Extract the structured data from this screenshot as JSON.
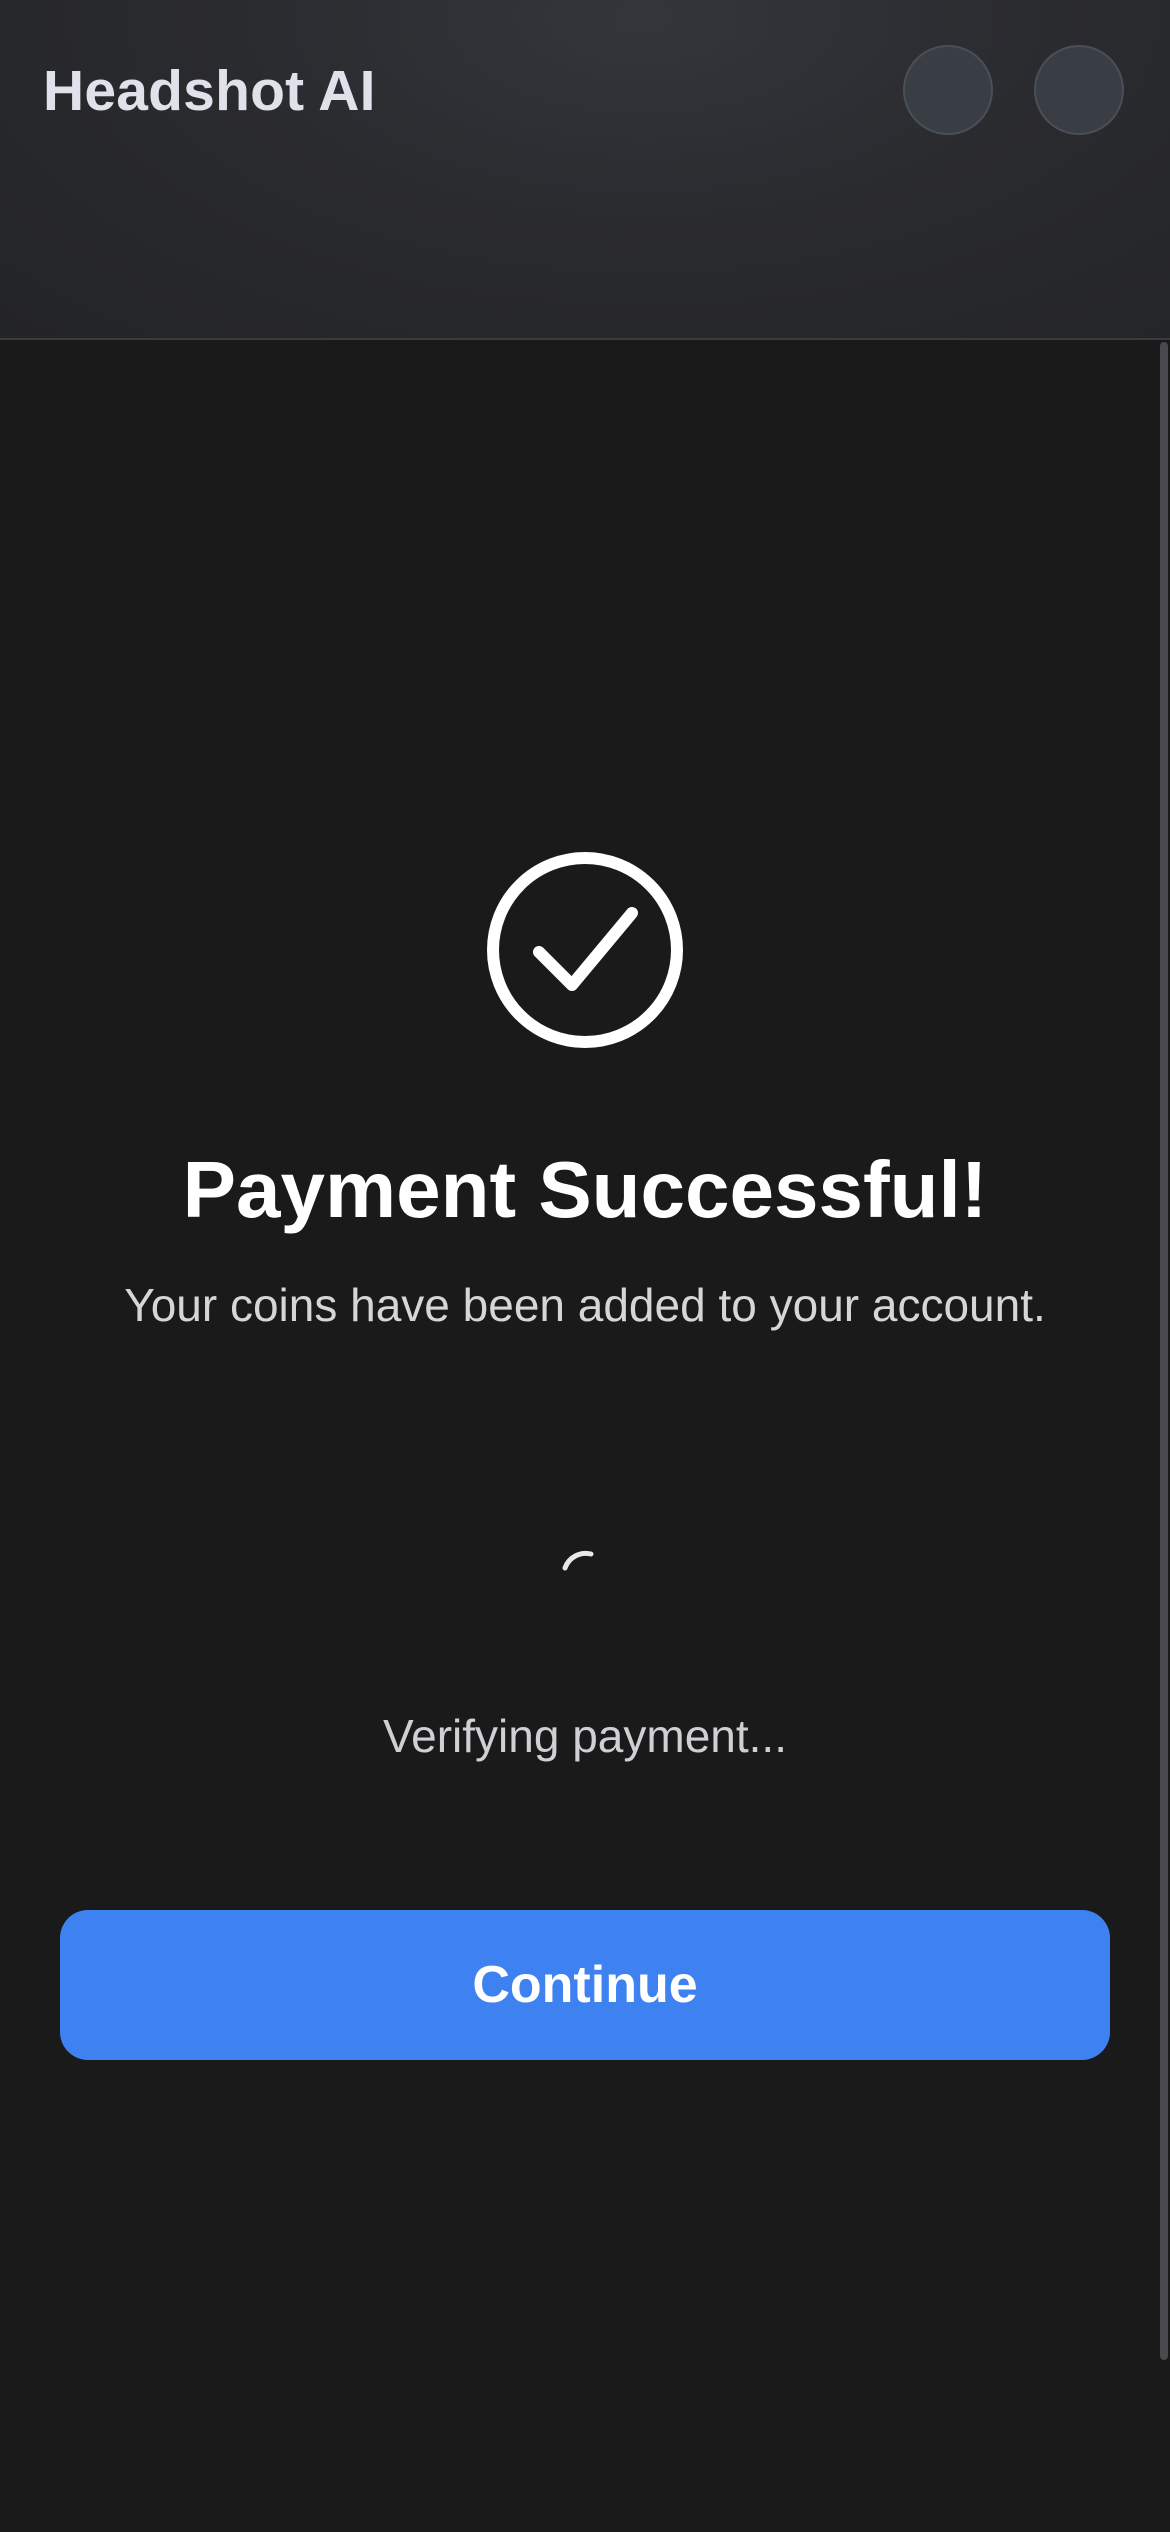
{
  "header": {
    "title": "Headshot AI",
    "button_1_icon": "circle-button",
    "button_2_icon": "circle-button"
  },
  "main": {
    "status_icon": "check-circle-icon",
    "title": "Payment Successful!",
    "subtitle": "Your coins have been added to your account.",
    "loading_icon": "spinner-icon",
    "status_text": "Verifying payment...",
    "continue_label": "Continue"
  },
  "colors": {
    "background": "#1a1a1b",
    "header_background": "#2a2b2f",
    "accent": "#3e82f1",
    "text_primary": "#ffffff",
    "text_secondary": "#d6d6d8"
  }
}
